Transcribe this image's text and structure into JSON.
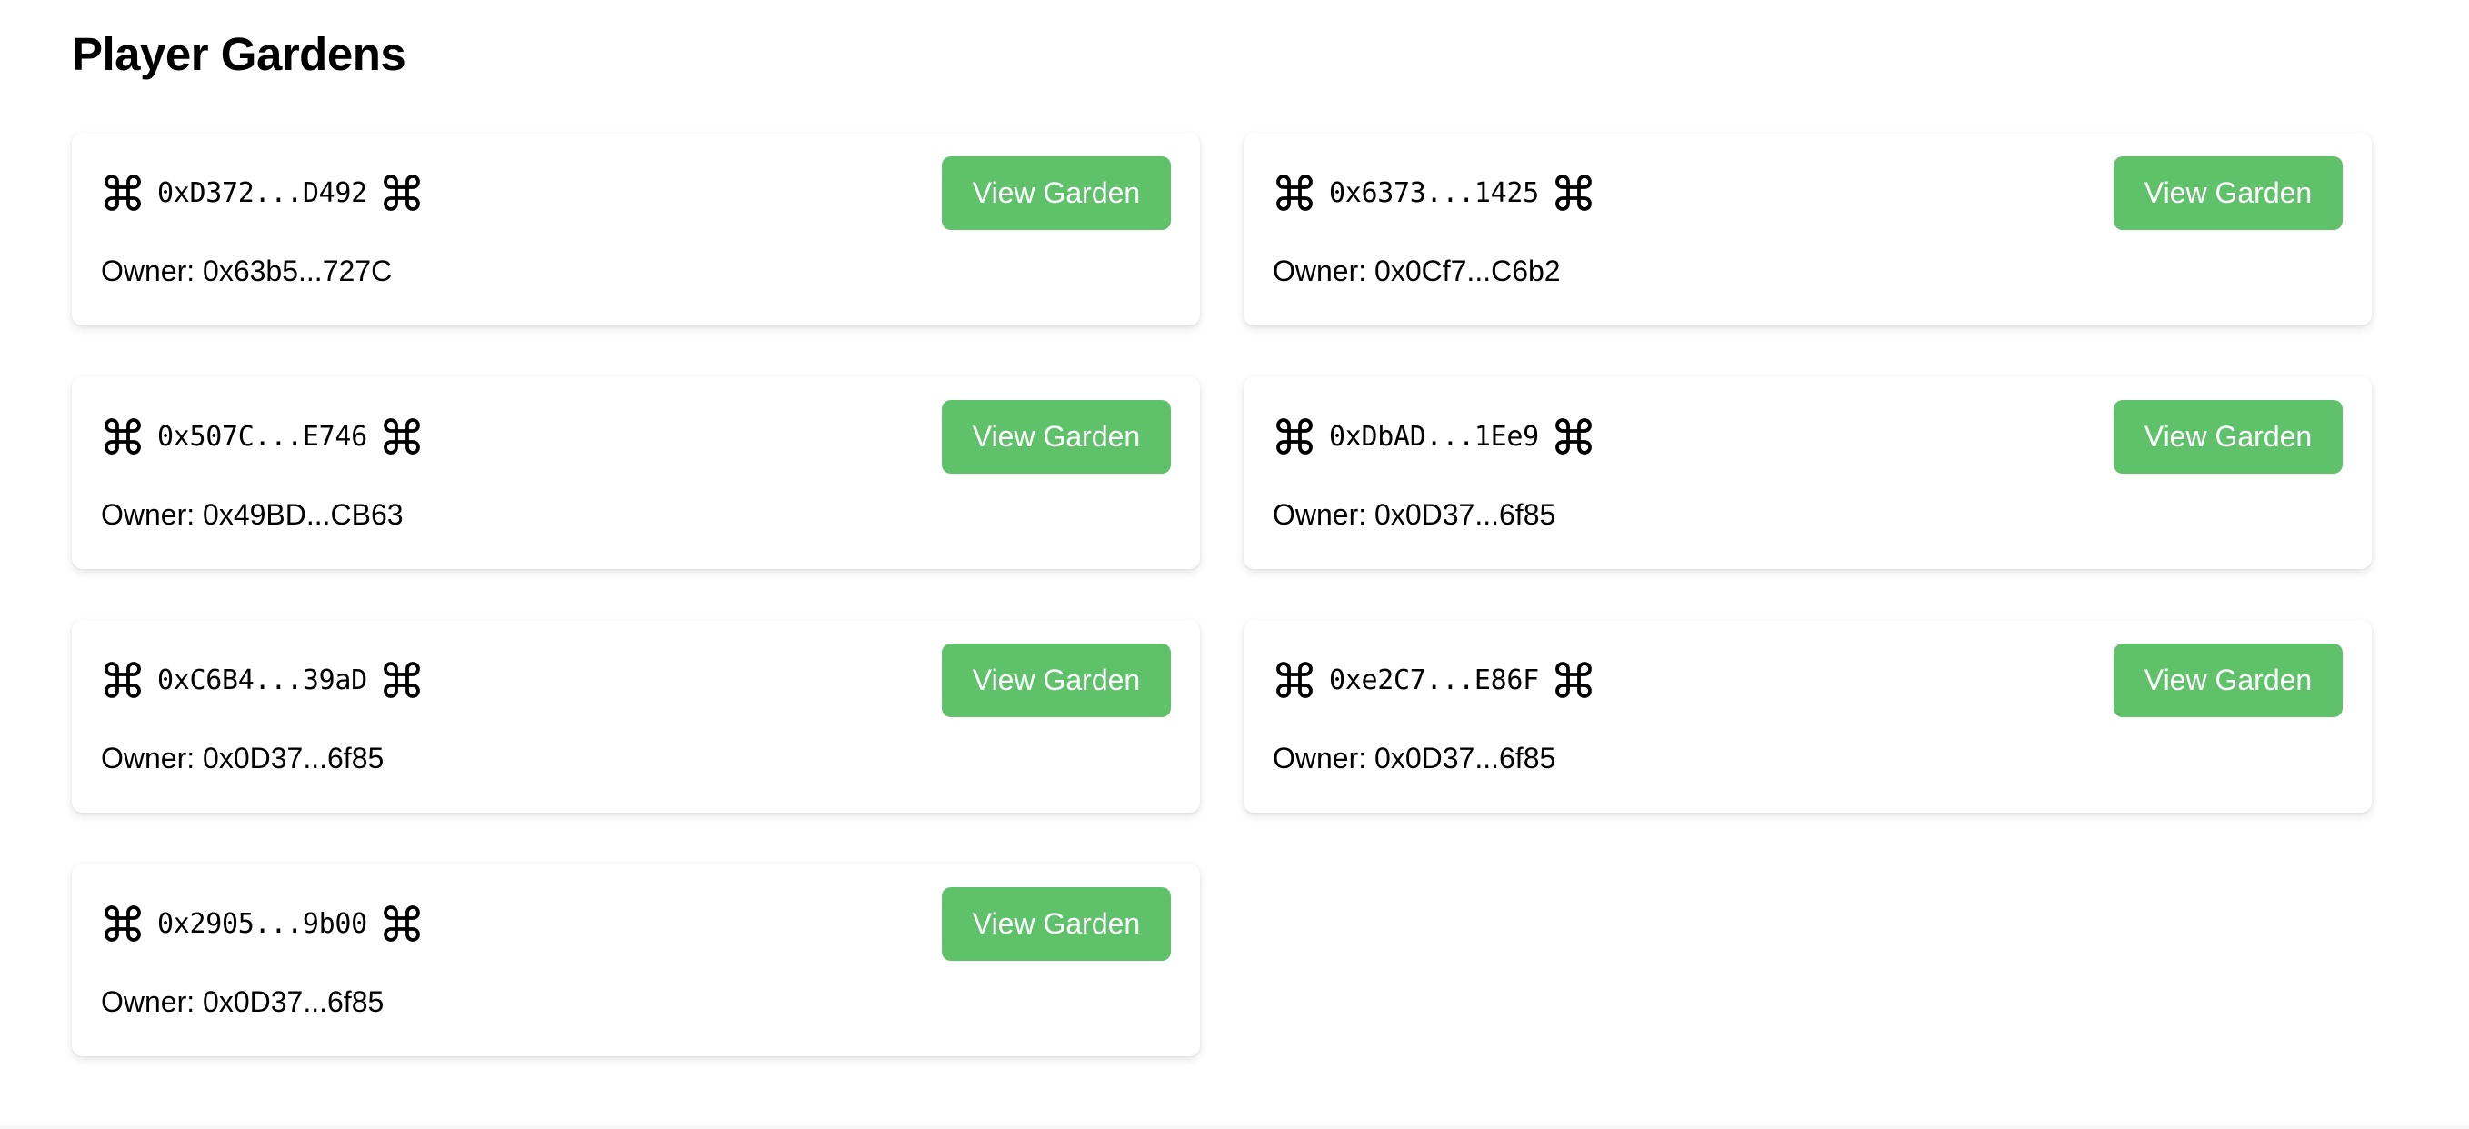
{
  "page": {
    "title": "Player Gardens"
  },
  "gardens": [
    {
      "address": "0xD372...D492",
      "owner_label": "Owner: 0x63b5...727C",
      "button_label": "View Garden"
    },
    {
      "address": "0x6373...1425",
      "owner_label": "Owner: 0x0Cf7...C6b2",
      "button_label": "View Garden"
    },
    {
      "address": "0x507C...E746",
      "owner_label": "Owner: 0x49BD...CB63",
      "button_label": "View Garden"
    },
    {
      "address": "0xDbAD...1Ee9",
      "owner_label": "Owner: 0x0D37...6f85",
      "button_label": "View Garden"
    },
    {
      "address": "0xC6B4...39aD",
      "owner_label": "Owner: 0x0D37...6f85",
      "button_label": "View Garden"
    },
    {
      "address": "0xe2C7...E86F",
      "owner_label": "Owner: 0x0D37...6f85",
      "button_label": "View Garden"
    },
    {
      "address": "0x2905...9b00",
      "owner_label": "Owner: 0x0D37...6f85",
      "button_label": "View Garden"
    }
  ],
  "icons": {
    "address_prefix": "command-key-icon",
    "address_suffix": "command-key-icon"
  },
  "colors": {
    "button_background": "#5fc26b",
    "button_text": "#ffffff"
  }
}
